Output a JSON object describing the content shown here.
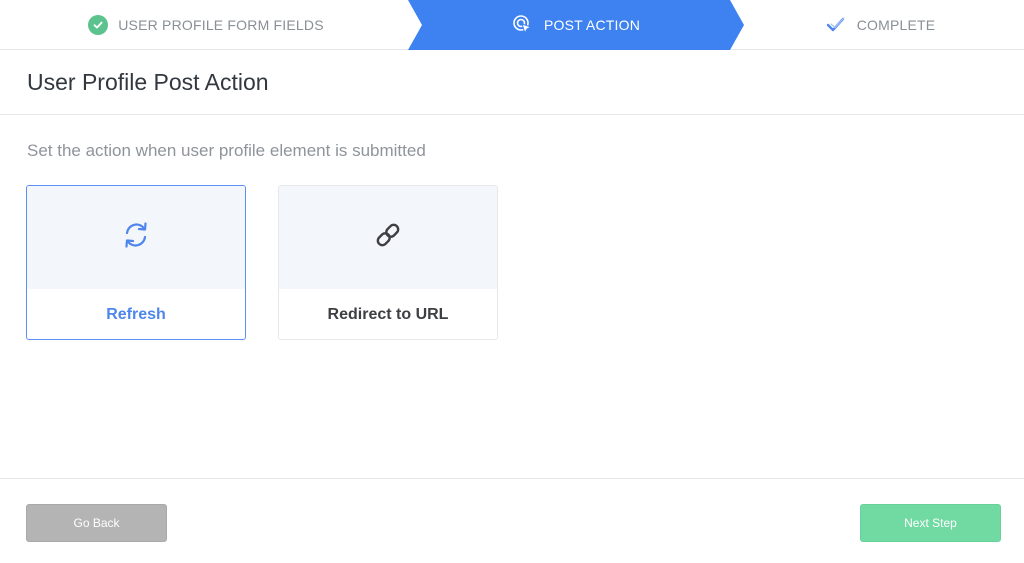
{
  "stepper": {
    "steps": [
      {
        "label": "USER PROFILE FORM FIELDS",
        "state": "done",
        "icon": "check-circle-icon"
      },
      {
        "label": "POST ACTION",
        "state": "active",
        "icon": "pointer-click-icon"
      },
      {
        "label": "COMPLETE",
        "state": "pending",
        "icon": "checkmark-icon"
      }
    ],
    "colors": {
      "active": "#3d82f0",
      "done": "#5cc38e",
      "pending_icon": "#4f86ec"
    }
  },
  "header": {
    "title": "User Profile Post Action"
  },
  "main": {
    "subtitle": "Set the action when user profile element is submitted",
    "options": [
      {
        "label": "Refresh",
        "icon": "refresh-icon",
        "selected": true
      },
      {
        "label": "Redirect to URL",
        "icon": "link-icon",
        "selected": false
      }
    ]
  },
  "footer": {
    "back_label": "Go Back",
    "next_label": "Next Step"
  }
}
